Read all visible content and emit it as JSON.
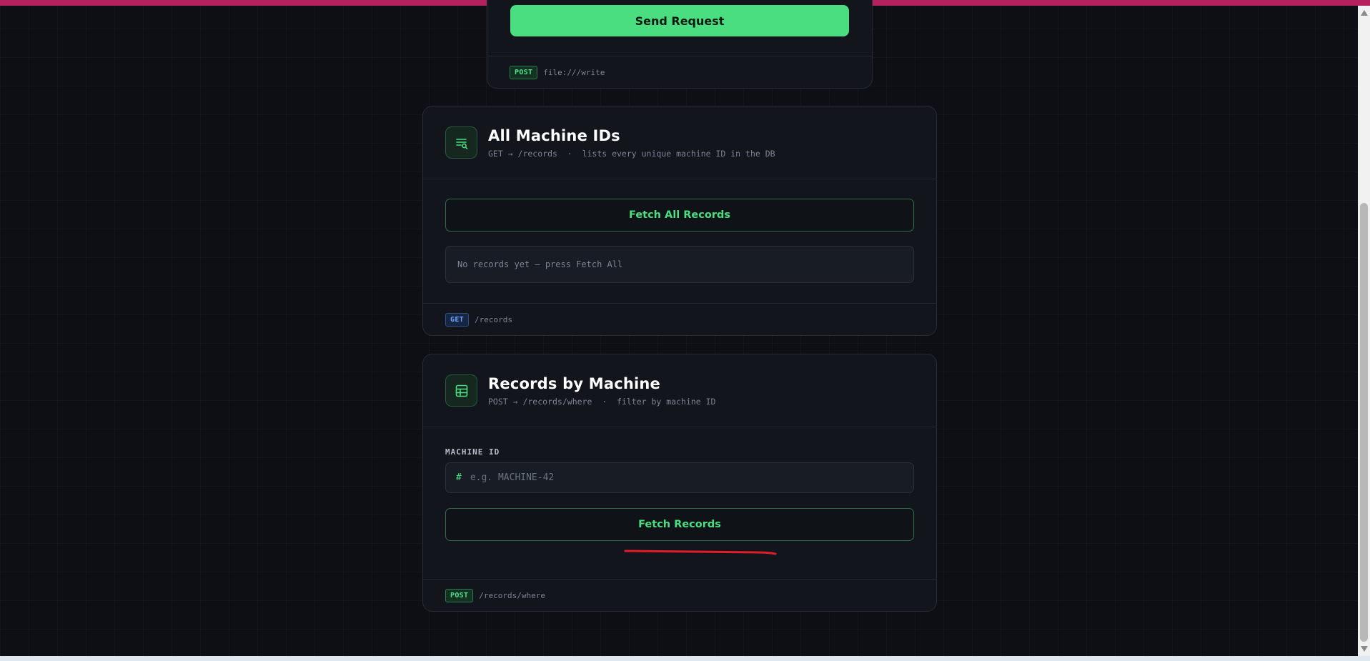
{
  "write_card": {
    "send_button_label": "Send Request",
    "footer_method": "POST",
    "footer_path": "file:///write"
  },
  "all_ids_card": {
    "title": "All Machine IDs",
    "subtitle": "GET → /records  ·  lists every unique machine ID in the DB",
    "fetch_all_label": "Fetch All Records",
    "output_text": "No records yet — press Fetch All",
    "footer_method": "GET",
    "footer_path": "/records",
    "icon": "list-search-icon"
  },
  "by_machine_card": {
    "title": "Records by Machine",
    "subtitle": "POST → /records/where  ·  filter by machine ID",
    "machine_id_label": "MACHINE ID",
    "input_prefix": "#",
    "input_placeholder": "e.g. MACHINE-42",
    "input_value": "",
    "fetch_label": "Fetch Records",
    "footer_method": "POST",
    "footer_path": "/records/where",
    "icon": "table-icon"
  },
  "colors": {
    "accent_green": "#4ade80",
    "background": "#0d0f14",
    "card": "#12151c",
    "top_bar": "#b5205f",
    "annotation_red": "#e11d2a",
    "get_badge": "#6ea2ff"
  }
}
